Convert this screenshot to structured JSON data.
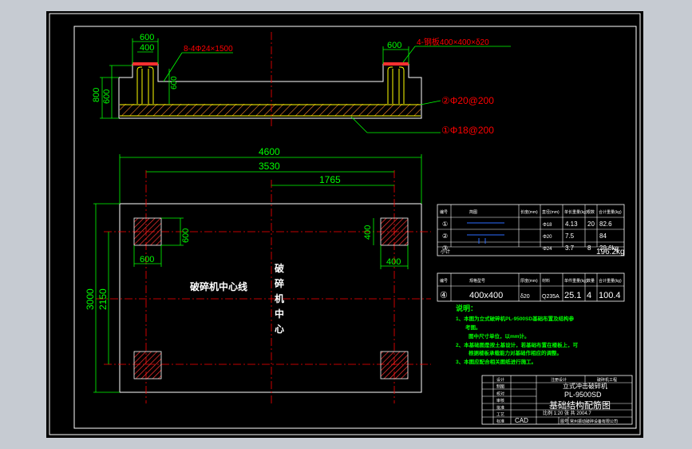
{
  "colors": {
    "background": "#000000",
    "frame": "#ffffff",
    "dimension": "#00ff00",
    "centerline": "#ff0000",
    "hatch": "#ff3030",
    "rebar": "#ffff00",
    "annotation": "#ff0000",
    "title_text": "#ffffff",
    "notes_text": "#00ff00"
  },
  "section": {
    "dim_600_left": "600",
    "dim_400_left": "400",
    "dim_600_right": "600",
    "dim_600_vert": "600",
    "dim_800": "800",
    "dim_600_outer": "600",
    "bolt_note": "8-4Φ24×1500",
    "plate_note": "4-钢板400×400×δ20",
    "rebar2_note": "②Φ20@200",
    "rebar1_note": "①Φ18@200"
  },
  "plan": {
    "dim_4600": "4600",
    "dim_3530": "3530",
    "dim_1765": "1765",
    "dim_3000": "3000",
    "dim_2150": "2150",
    "dim_600_h": "600",
    "dim_600_v": "600",
    "dim_400_v": "400",
    "dim_400_h": "400",
    "crusher_centerline_h": "破碎机中心线",
    "crusher_centerline_v": "破碎机中心线"
  },
  "rebar_table": {
    "headers": [
      "编号",
      "简图",
      "长度(mm)",
      "直径(mm)",
      "单长重量(kg)",
      "根数",
      "合计重量(kg)"
    ],
    "rows": [
      [
        "①",
        "",
        "",
        "Φ18",
        "4.13",
        "20",
        "82.6"
      ],
      [
        "②",
        "",
        "",
        "Φ20",
        "7.5",
        "",
        "84"
      ],
      [
        "③",
        "",
        "",
        "Φ24",
        "3.7",
        "8",
        "29.6kg"
      ]
    ],
    "total_label": "小计",
    "total": "196.2kg"
  },
  "plate_table": {
    "headers": [
      "编号",
      "规格型号",
      "厚度(mm)",
      "材料",
      "单件重量(kg)",
      "数量",
      "合计重量(kg)"
    ],
    "row": [
      "④",
      "400x400",
      "δ20",
      "Q235A",
      "25.1",
      "4",
      "100.4"
    ]
  },
  "notes": {
    "title": "说明：",
    "line1": "1、本图为立式破碎机PL-9500SD基础布置及结构参",
    "line1b": "考图。",
    "line2": "图中尺寸单位，以mm计。",
    "line3": "2、本基础图是按土基设计，若基础布置在楼板上，可",
    "line3b": "根据楼板承载能力对基础作相应的调整。",
    "line4": "3、本图应配合相关图纸进行施工。"
  },
  "title_block": {
    "top_left": "注册设计",
    "top_right": "破碎机工程",
    "labels": [
      "设计",
      "制图",
      "校对",
      "审核",
      "批准",
      "工艺",
      "标准"
    ],
    "product_name": "立式冲击破碎机",
    "model": "PL-9500SD",
    "drawing_name": "基础结构配筋图",
    "scale_row": "比例  1:20  张  共  2004.7",
    "cad": "CAD",
    "drawing_no_label": "图号",
    "company": "常州振动破碎设备有限公司"
  }
}
